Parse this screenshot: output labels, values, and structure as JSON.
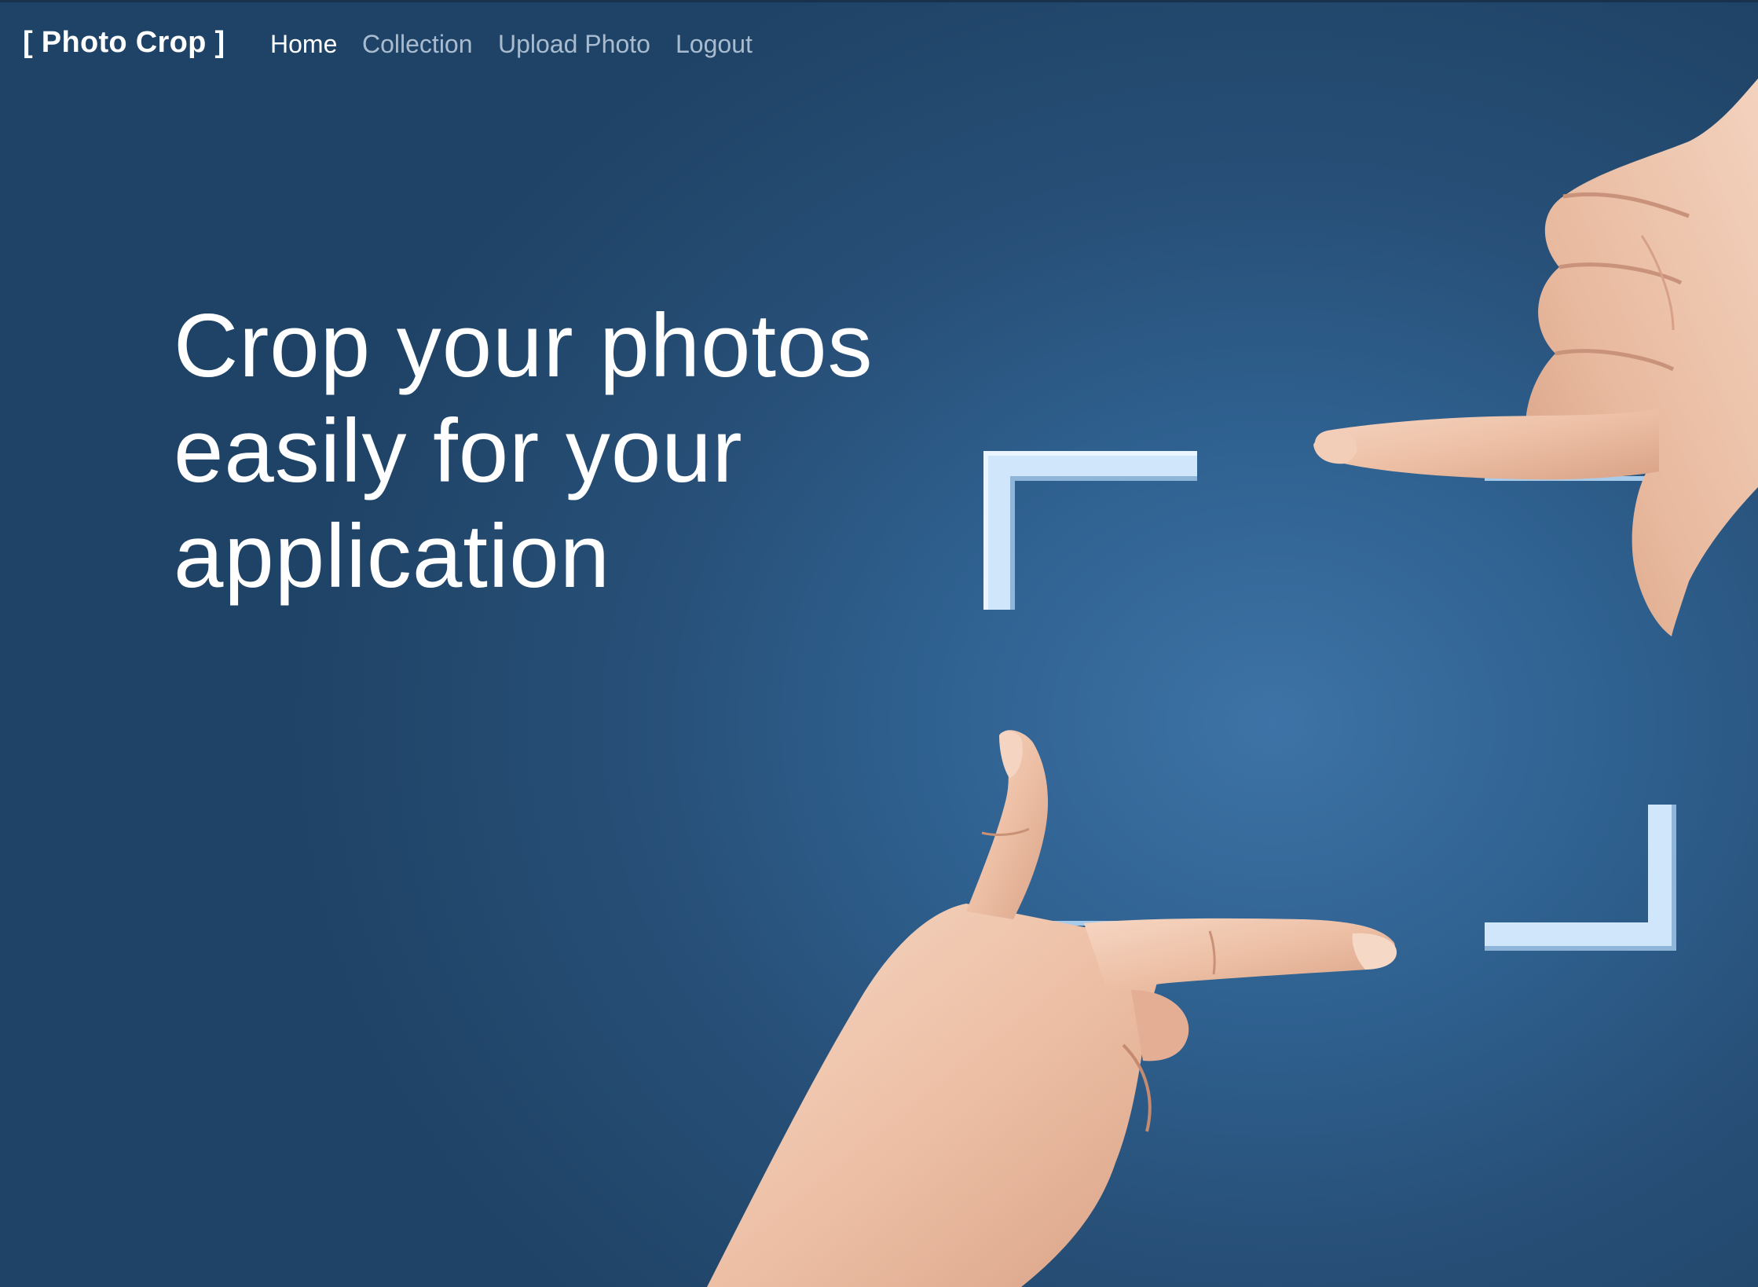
{
  "navbar": {
    "brand": "[ Photo Crop ]",
    "links": [
      {
        "label": "Home",
        "active": true
      },
      {
        "label": "Collection",
        "active": false
      },
      {
        "label": "Upload Photo",
        "active": false
      },
      {
        "label": "Logout",
        "active": false
      }
    ]
  },
  "hero": {
    "headline_lines": [
      "Crop your photos",
      "easily for your",
      "application"
    ],
    "background_colors": {
      "center": "#3d73a6",
      "edge": "#1f4366"
    },
    "frame_color": "#cfe6fb"
  }
}
